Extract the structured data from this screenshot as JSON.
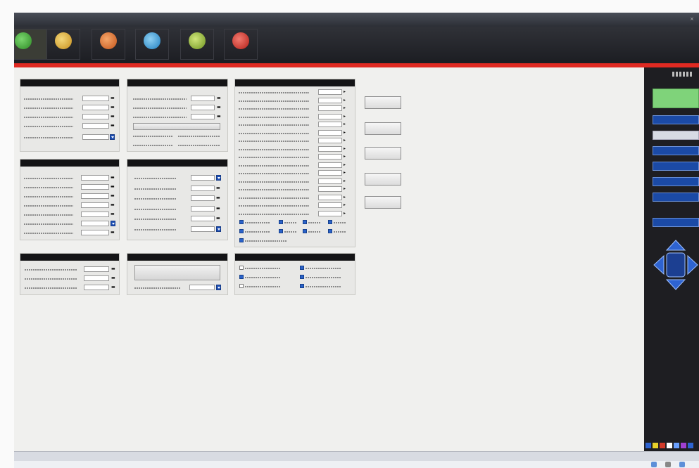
{
  "window": {
    "title": ""
  },
  "toolbar": {
    "buttons": [
      {
        "label": "",
        "color": "#47b33c"
      },
      {
        "label": "",
        "color": "#e0b43a"
      },
      {
        "label": "",
        "color": "#e2772a"
      },
      {
        "label": "",
        "color": "#3fa3dc"
      },
      {
        "label": "",
        "color": "#9cc23a"
      },
      {
        "label": "",
        "color": "#d8332b"
      }
    ]
  },
  "panels": {
    "p1": {
      "title": "",
      "fields": [
        {
          "label": "",
          "value": ""
        },
        {
          "label": "",
          "value": ""
        },
        {
          "label": "",
          "value": ""
        },
        {
          "label": "",
          "value": ""
        },
        {
          "label": "",
          "value": ""
        }
      ]
    },
    "p2": {
      "title": "",
      "fields": [
        {
          "label": "",
          "value": ""
        },
        {
          "label": "",
          "value": ""
        },
        {
          "label": "",
          "value": ""
        }
      ],
      "button": "",
      "sublabels": [
        "",
        "",
        "",
        ""
      ]
    },
    "p3": {
      "title": "",
      "fields": [
        {
          "label": "",
          "value": ""
        },
        {
          "label": "",
          "value": ""
        },
        {
          "label": "",
          "value": ""
        },
        {
          "label": "",
          "value": ""
        },
        {
          "label": "",
          "value": ""
        },
        {
          "label": "",
          "value": ""
        },
        {
          "label": "",
          "value": ""
        },
        {
          "label": "",
          "value": ""
        },
        {
          "label": "",
          "value": ""
        },
        {
          "label": "",
          "value": ""
        },
        {
          "label": "",
          "value": ""
        },
        {
          "label": "",
          "value": ""
        },
        {
          "label": "",
          "value": ""
        },
        {
          "label": "",
          "value": ""
        },
        {
          "label": "",
          "value": ""
        },
        {
          "label": "",
          "value": ""
        }
      ],
      "checks": [
        "",
        "",
        "",
        "",
        "",
        "",
        "",
        "",
        ""
      ]
    },
    "p4": {
      "title": "",
      "fields": [
        {
          "label": "",
          "value": ""
        },
        {
          "label": "",
          "value": ""
        },
        {
          "label": "",
          "value": ""
        },
        {
          "label": "",
          "value": ""
        },
        {
          "label": "",
          "value": ""
        },
        {
          "label": "",
          "value": ""
        },
        {
          "label": "",
          "value": ""
        }
      ]
    },
    "p5": {
      "title": "",
      "fields": [
        {
          "label": "",
          "value": ""
        },
        {
          "label": "",
          "value": ""
        },
        {
          "label": "",
          "value": ""
        },
        {
          "label": "",
          "value": ""
        },
        {
          "label": "",
          "value": ""
        },
        {
          "label": "",
          "value": ""
        }
      ]
    },
    "p6": {
      "title": "",
      "fields": [
        {
          "label": "",
          "value": ""
        },
        {
          "label": "",
          "value": ""
        },
        {
          "label": "",
          "value": ""
        }
      ]
    },
    "p7": {
      "title": "",
      "button": "",
      "field": {
        "label": "",
        "value": ""
      }
    },
    "p8": {
      "title": "",
      "checks": [
        "",
        "",
        "",
        "",
        "",
        ""
      ]
    }
  },
  "side_buttons": [
    "",
    "",
    "",
    "",
    ""
  ],
  "right_panel": {
    "header": "",
    "status": {
      "line1": "",
      "line2": ""
    },
    "items": [
      "",
      "",
      "",
      "",
      "",
      "",
      ""
    ],
    "item_lower": "",
    "dpad_center": ""
  },
  "colors": {
    "accent_red": "#e02a22",
    "panel_blue": "#1b4aa6"
  }
}
